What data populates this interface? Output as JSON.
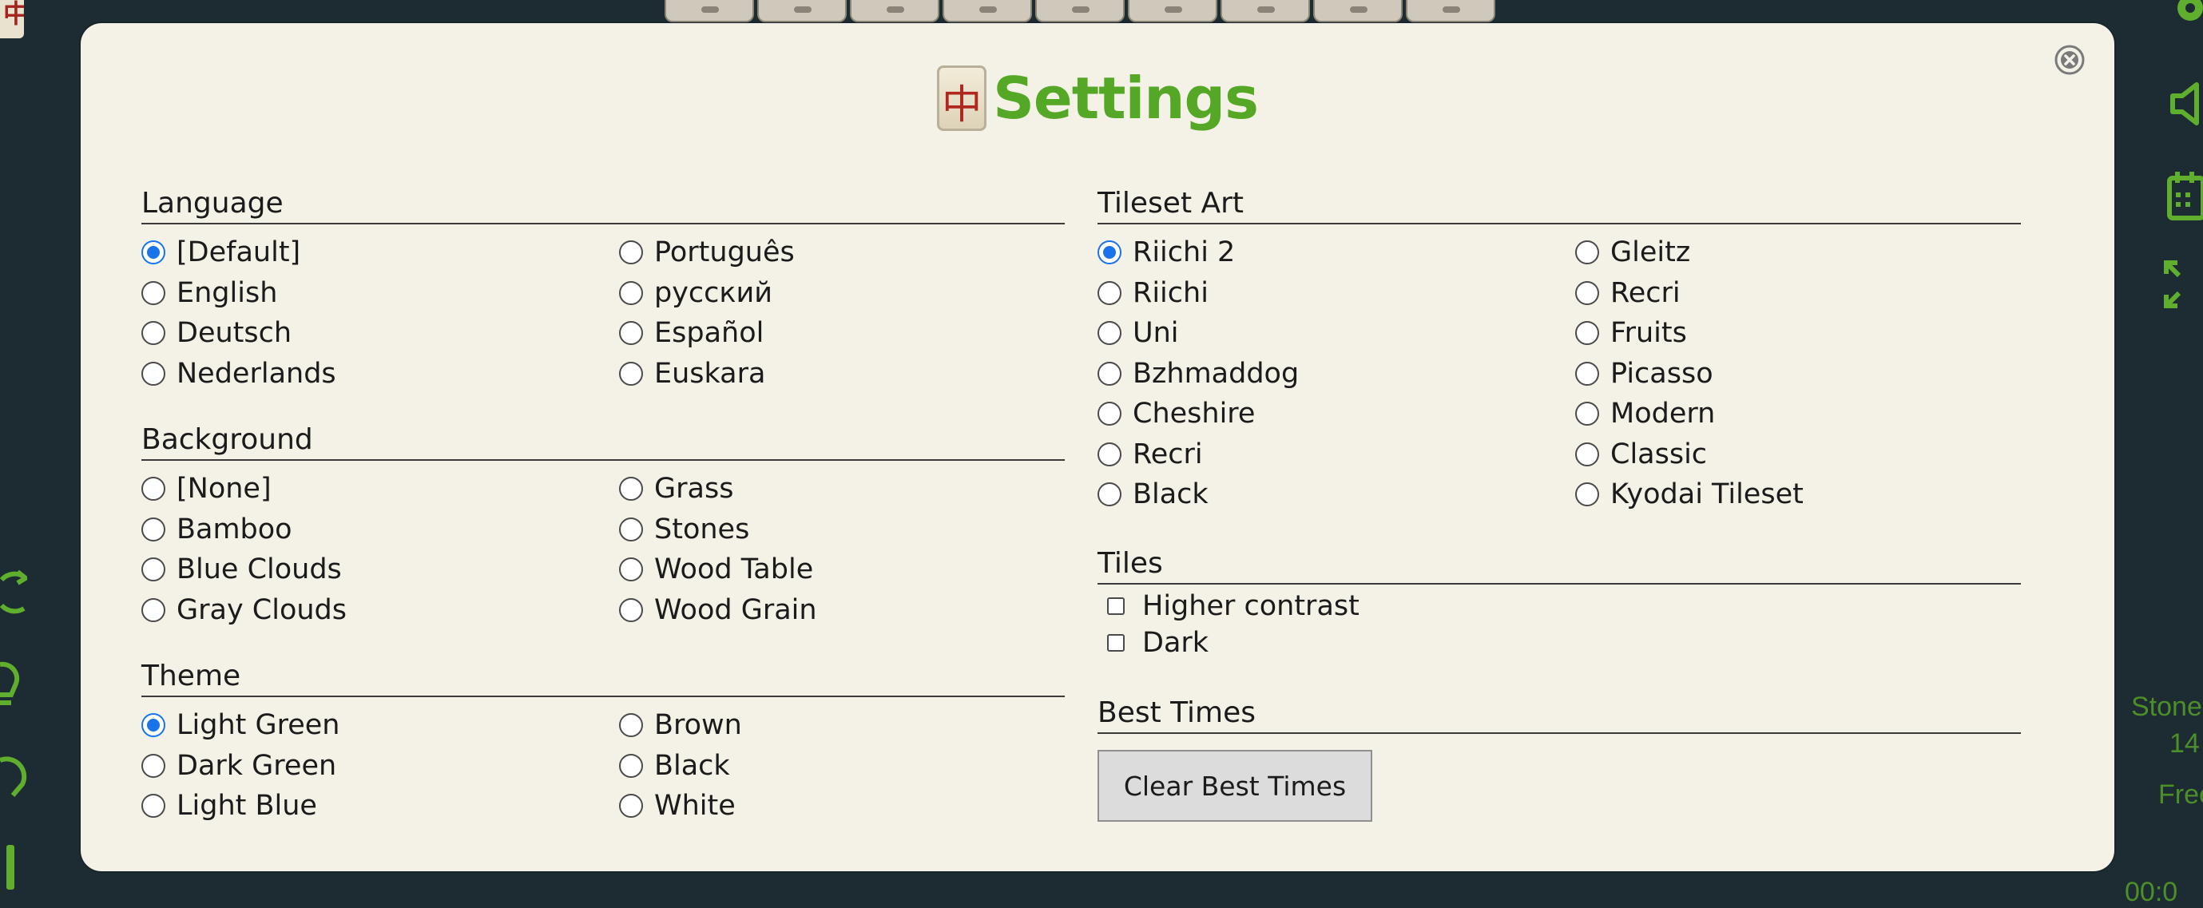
{
  "app": {
    "title": "Settings",
    "title_tile_glyph": "中",
    "close_icon": "close-icon"
  },
  "background_game": {
    "corner_tile_glyph": "中",
    "side_stats": {
      "layout_name": "Stone",
      "count": "14",
      "free_label": "Free",
      "timer": "00:0"
    }
  },
  "language": {
    "heading": "Language",
    "options": [
      {
        "label": "[Default]",
        "checked": true
      },
      {
        "label": "Português",
        "checked": false
      },
      {
        "label": "English",
        "checked": false
      },
      {
        "label": "русский",
        "checked": false
      },
      {
        "label": "Deutsch",
        "checked": false
      },
      {
        "label": "Español",
        "checked": false
      },
      {
        "label": "Nederlands",
        "checked": false
      },
      {
        "label": "Euskara",
        "checked": false
      }
    ]
  },
  "background": {
    "heading": "Background",
    "options": [
      {
        "label": "[None]",
        "checked": false
      },
      {
        "label": "Grass",
        "checked": false
      },
      {
        "label": "Bamboo",
        "checked": false
      },
      {
        "label": "Stones",
        "checked": false
      },
      {
        "label": "Blue Clouds",
        "checked": false
      },
      {
        "label": "Wood Table",
        "checked": false
      },
      {
        "label": "Gray Clouds",
        "checked": false
      },
      {
        "label": "Wood Grain",
        "checked": false
      }
    ]
  },
  "theme": {
    "heading": "Theme",
    "options": [
      {
        "label": "Light Green",
        "checked": true
      },
      {
        "label": "Brown",
        "checked": false
      },
      {
        "label": "Dark Green",
        "checked": false
      },
      {
        "label": "Black",
        "checked": false
      },
      {
        "label": "Light Blue",
        "checked": false
      },
      {
        "label": "White",
        "checked": false
      }
    ]
  },
  "tileset": {
    "heading": "Tileset Art",
    "options": [
      {
        "label": "Riichi 2",
        "checked": true
      },
      {
        "label": "Gleitz",
        "checked": false
      },
      {
        "label": "Riichi",
        "checked": false
      },
      {
        "label": "Recri",
        "checked": false
      },
      {
        "label": "Uni",
        "checked": false
      },
      {
        "label": "Fruits",
        "checked": false
      },
      {
        "label": "Bzhmaddog",
        "checked": false
      },
      {
        "label": "Picasso",
        "checked": false
      },
      {
        "label": "Cheshire",
        "checked": false
      },
      {
        "label": "Modern",
        "checked": false
      },
      {
        "label": "Recri",
        "checked": false
      },
      {
        "label": "Classic",
        "checked": false
      },
      {
        "label": "Black",
        "checked": false
      },
      {
        "label": "Kyodai Tileset",
        "checked": false
      }
    ]
  },
  "tiles": {
    "heading": "Tiles",
    "options": [
      {
        "label": "Higher contrast",
        "checked": false
      },
      {
        "label": "Dark",
        "checked": false
      }
    ]
  },
  "best_times": {
    "heading": "Best Times",
    "clear_label": "Clear Best Times"
  },
  "colors": {
    "accent": "#54a826",
    "selected_radio": "#1a73e8",
    "modal_bg": "#f4f1e6",
    "page_bg": "#1d2b33"
  }
}
